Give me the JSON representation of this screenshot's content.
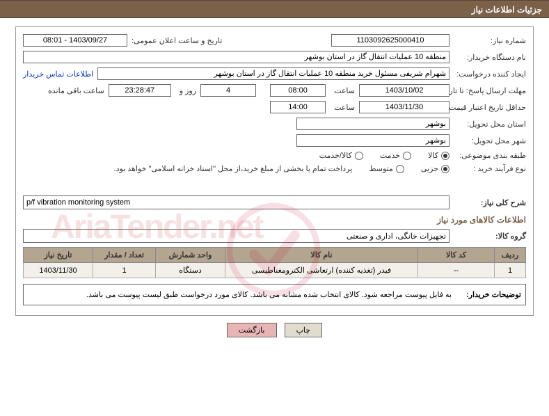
{
  "header": {
    "title": "جزئیات اطلاعات نیاز"
  },
  "fields": {
    "need_number_label": "شماره نیاز:",
    "need_number": "1103092625000410",
    "announce_datetime_label": "تاریخ و ساعت اعلان عمومی:",
    "announce_datetime": "1403/09/27 - 08:01",
    "buyer_org_label": "نام دستگاه خریدار:",
    "buyer_org": "منطقه 10 عملیات انتقال گاز در استان بوشهر",
    "requester_label": "ایجاد کننده درخواست:",
    "requester": "شهرام شریفی مسئول خرید منطقه 10 عملیات انتقال گاز در استان بوشهر",
    "contact_link": "اطلاعات تماس خریدار",
    "reply_deadline_label": "مهلت ارسال پاسخ: تا تاریخ:",
    "reply_deadline_date": "1403/10/02",
    "time_label": "ساعت",
    "reply_deadline_time": "08:00",
    "days_remaining": "4",
    "days_and_label": "روز و",
    "time_remaining": "23:28:47",
    "time_remaining_suffix": "ساعت باقی مانده",
    "price_valid_label": "حداقل تاریخ اعتبار قیمت: تا تاریخ:",
    "price_valid_date": "1403/11/30",
    "price_valid_time": "14:00",
    "delivery_province_label": "استان محل تحویل:",
    "delivery_province": "بوشهر",
    "delivery_city_label": "شهر محل تحویل:",
    "delivery_city": "بوشهر",
    "subject_class_label": "طبقه بندی موضوعی:",
    "radio_goods": "کالا",
    "radio_service": "خدمت",
    "radio_goods_service": "کالا/خدمت",
    "buy_process_label": "نوع فرآیند خرید :",
    "radio_partial": "جزیی",
    "radio_medium": "متوسط",
    "payment_note": "پرداخت تمام یا بخشی از مبلغ خرید،از محل \"اسناد خزانه اسلامی\" خواهد بود."
  },
  "need_summary": {
    "label": "شرح کلی نیاز:",
    "value": "p/f vibration monitoring system"
  },
  "goods_section": {
    "title": "اطلاعات کالاهای مورد نیاز",
    "group_label": "گروه کالا:",
    "group_value": "تجهیزات خانگی، اداری و صنعتی"
  },
  "table": {
    "headers": {
      "row": "ردیف",
      "code": "کد کالا",
      "name": "نام کالا",
      "unit": "واحد شمارش",
      "qty": "تعداد / مقدار",
      "date": "تاریخ نیاز"
    },
    "rows": [
      {
        "row": "1",
        "code": "--",
        "name": "فیدر (تغذیه کننده) ارتعاشی الکترومغناطیسی",
        "unit": "دستگاه",
        "qty": "1",
        "date": "1403/11/30"
      }
    ]
  },
  "buyer_note": {
    "label": "توضیحات خریدار:",
    "text": "به فایل پیوست مراجعه شود. کالای انتخاب شده مشابه می باشد. کالای مورد درخواست طبق لیست پیوست می باشد."
  },
  "buttons": {
    "print": "چاپ",
    "back": "بازگشت"
  },
  "watermark": "AriaTender.net"
}
